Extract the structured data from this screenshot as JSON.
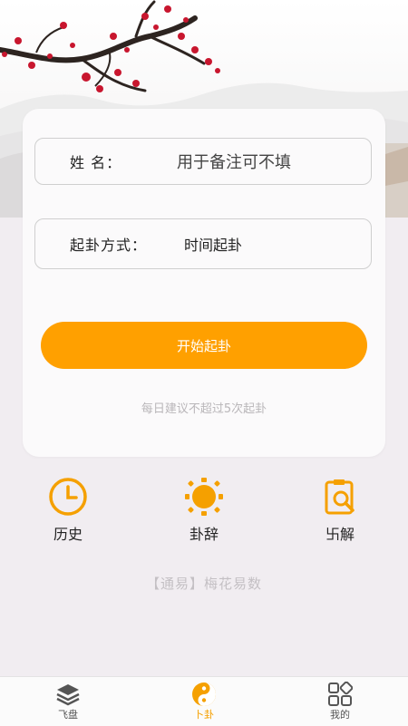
{
  "form": {
    "name_label": "姓 名：",
    "name_placeholder": "用于备注可不填",
    "method_label": "起卦方式：",
    "method_value": "时间起卦"
  },
  "start_button": "开始起卦",
  "hint": "每日建议不超过5次起卦",
  "actions": [
    {
      "label": "历史",
      "icon": "clock-icon"
    },
    {
      "label": "卦辞",
      "icon": "sun-icon"
    },
    {
      "label": "卐解",
      "icon": "clipboard-search-icon"
    }
  ],
  "brand": "【通易】梅花易数",
  "tabs": [
    {
      "label": "飞盘",
      "icon": "layers-icon"
    },
    {
      "label": "卜卦",
      "icon": "yin-yang-icon"
    },
    {
      "label": "我的",
      "icon": "grid-icon"
    }
  ],
  "colors": {
    "accent": "#ffa000",
    "background": "#f1edf1",
    "card": "#fbfafb"
  }
}
